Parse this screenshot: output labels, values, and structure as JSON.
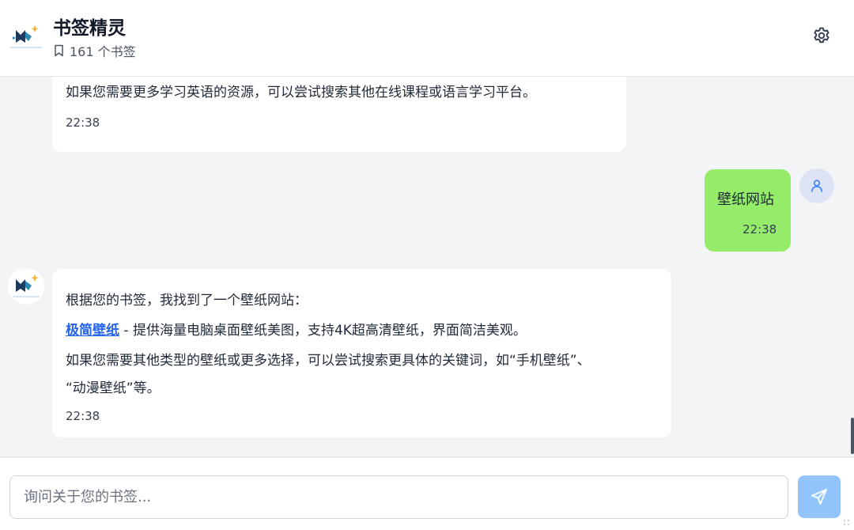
{
  "header": {
    "title": "书签精灵",
    "bookmark_count": "161 个书签",
    "logo_caption": "BOOKMARK"
  },
  "messages": {
    "bot1": {
      "text": "如果您需要更多学习英语的资源，可以尝试搜索其他在线课程或语言学习平台。",
      "time": "22:38"
    },
    "user1": {
      "text": "壁纸网站",
      "time": "22:38"
    },
    "bot2": {
      "intro": "根据您的书签，我找到了一个壁纸网站：",
      "link_text": "极简壁纸",
      "link_desc": " - 提供海量电脑桌面壁纸美图，支持4K超高清壁纸，界面简洁美观。",
      "line3": "如果您需要其他类型的壁纸或更多选择，可以尝试搜索更具体的关键词，如“手机壁纸”、",
      "line4": "“动漫壁纸”等。",
      "time": "22:38"
    }
  },
  "input": {
    "placeholder": "询问关于您的书签..."
  },
  "colors": {
    "user_bubble": "#95ec69",
    "send_button": "#93c5fd",
    "link": "#2563eb"
  },
  "icons": [
    "bookmark-icon",
    "gear-icon",
    "user-icon",
    "send-icon"
  ]
}
